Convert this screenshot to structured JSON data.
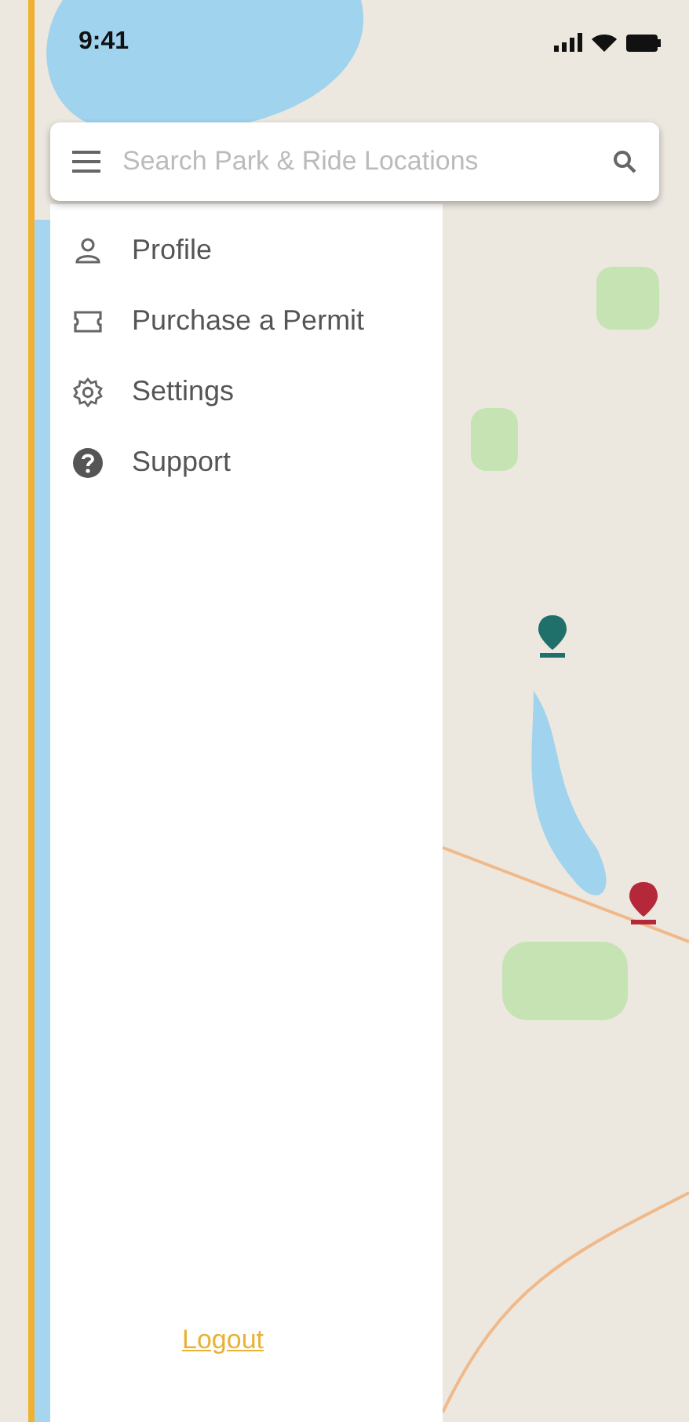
{
  "status_bar": {
    "time": "9:41"
  },
  "search": {
    "placeholder": "Search Park & Ride Locations"
  },
  "menu": [
    {
      "label": "Profile"
    },
    {
      "label": "Purchase a Permit"
    },
    {
      "label": "Settings"
    },
    {
      "label": "Support"
    }
  ],
  "logout": {
    "label": "Logout"
  },
  "map": {
    "pins": [
      {
        "color": "#1f6f6a"
      },
      {
        "color": "#b5283a"
      }
    ]
  }
}
